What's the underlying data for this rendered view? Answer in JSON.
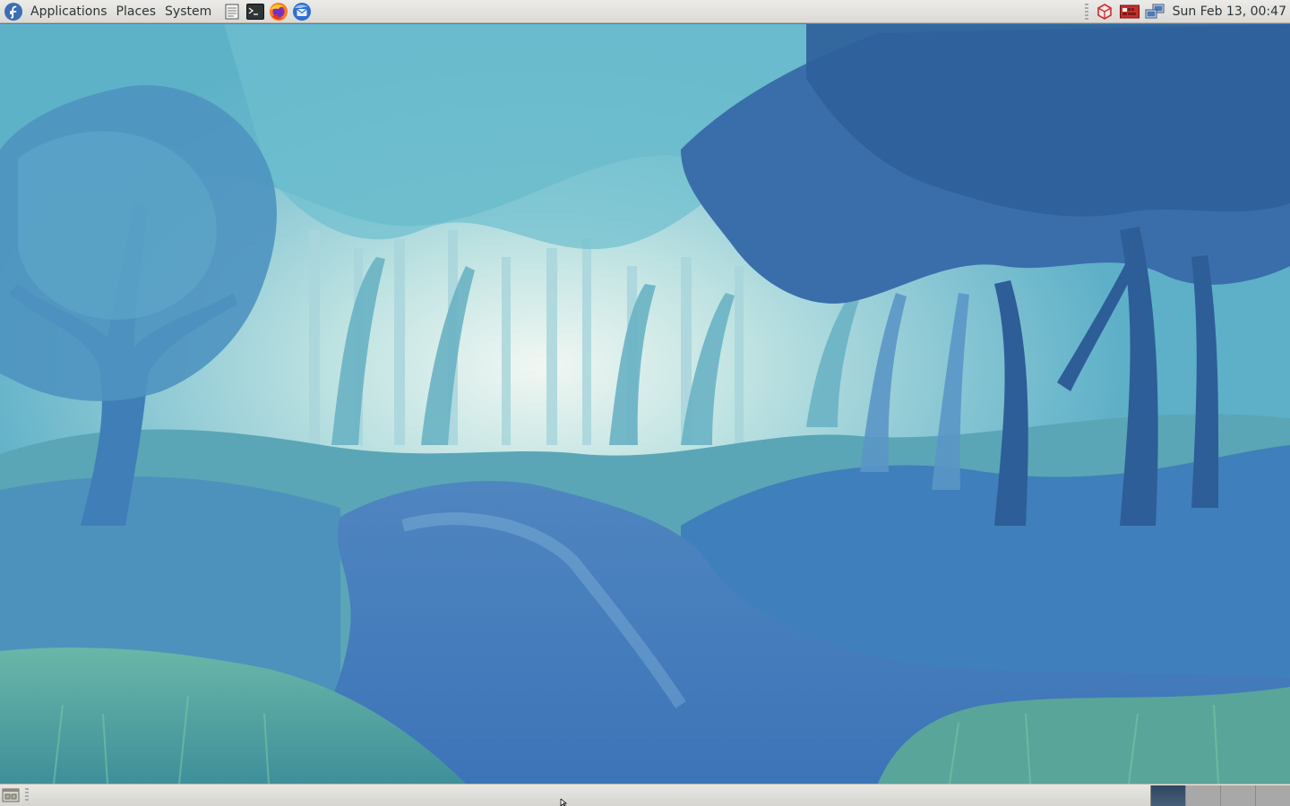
{
  "top_panel": {
    "menus": [
      {
        "label": "Applications"
      },
      {
        "label": "Places"
      },
      {
        "label": "System"
      }
    ],
    "launchers": [
      {
        "icon": "text-editor-icon"
      },
      {
        "icon": "terminal-icon"
      },
      {
        "icon": "firefox-icon"
      },
      {
        "icon": "thunderbird-icon"
      }
    ],
    "tray": {
      "icons": [
        "package-updates-icon",
        "keyboard-layout-icon",
        "network-icon"
      ],
      "clock": "Sun Feb 13, 00:47"
    }
  },
  "desktop": {
    "wallpaper": "misty blue forest with river painting"
  },
  "bottom_panel": {
    "show_desktop_icon": "show-desktop-icon",
    "workspaces": [
      {
        "active": true
      },
      {
        "active": false
      },
      {
        "active": false
      },
      {
        "active": false
      }
    ]
  },
  "colors": {
    "panel_bg": "#dcdad5",
    "distro_blue": "#3c6eb4",
    "active_workspace": "#3a526c"
  }
}
